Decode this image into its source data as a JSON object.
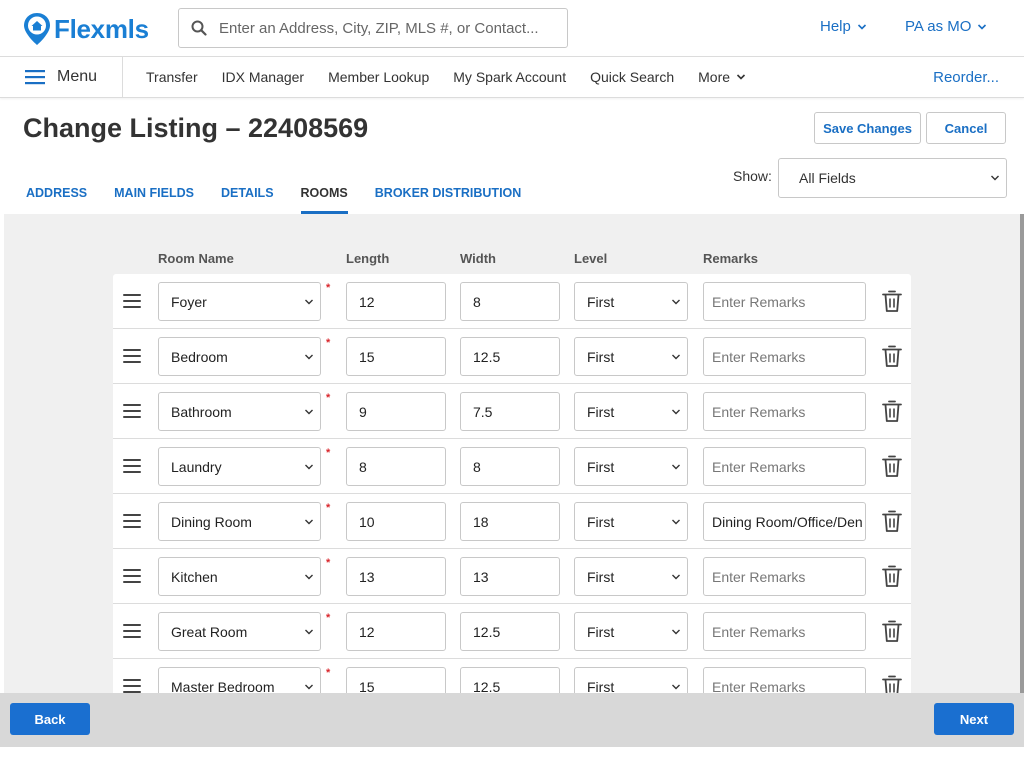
{
  "brand": {
    "name": "Flexmls",
    "color": "#1a7fd4"
  },
  "search": {
    "placeholder": "Enter an Address, City, ZIP, MLS #, or Contact..."
  },
  "header": {
    "help_label": "Help",
    "account_label": "PA as MO"
  },
  "nav": {
    "menu_label": "Menu",
    "items": [
      "Transfer",
      "IDX Manager",
      "Member Lookup",
      "My Spark Account",
      "Quick Search"
    ],
    "more_label": "More",
    "reorder_label": "Reorder..."
  },
  "page": {
    "title": "Change Listing – 22408569",
    "save_label": "Save Changes",
    "cancel_label": "Cancel",
    "tabs": [
      "ADDRESS",
      "MAIN FIELDS",
      "DETAILS",
      "ROOMS",
      "BROKER DISTRIBUTION"
    ],
    "active_tab": "ROOMS",
    "show_label": "Show:",
    "show_value": "All Fields"
  },
  "rooms": {
    "headers": {
      "name": "Room Name",
      "length": "Length",
      "width": "Width",
      "level": "Level",
      "remarks": "Remarks"
    },
    "remarks_placeholder": "Enter Remarks",
    "required_marker": "*",
    "rows": [
      {
        "name": "Foyer",
        "length": "12",
        "width": "8",
        "level": "First",
        "remarks": ""
      },
      {
        "name": "Bedroom",
        "length": "15",
        "width": "12.5",
        "level": "First",
        "remarks": ""
      },
      {
        "name": "Bathroom",
        "length": "9",
        "width": "7.5",
        "level": "First",
        "remarks": ""
      },
      {
        "name": "Laundry",
        "length": "8",
        "width": "8",
        "level": "First",
        "remarks": ""
      },
      {
        "name": "Dining Room",
        "length": "10",
        "width": "18",
        "level": "First",
        "remarks": "Dining Room/Office/Den"
      },
      {
        "name": "Kitchen",
        "length": "13",
        "width": "13",
        "level": "First",
        "remarks": ""
      },
      {
        "name": "Great Room",
        "length": "12",
        "width": "12.5",
        "level": "First",
        "remarks": ""
      },
      {
        "name": "Master Bedroom",
        "length": "15",
        "width": "12.5",
        "level": "First",
        "remarks": ""
      }
    ]
  },
  "footer": {
    "back_label": "Back",
    "next_label": "Next"
  },
  "colors": {
    "accent": "#1a6fc4",
    "primary_button": "#1a6fd0",
    "required": "#d9262c",
    "content_bg": "#f0f0f0"
  }
}
